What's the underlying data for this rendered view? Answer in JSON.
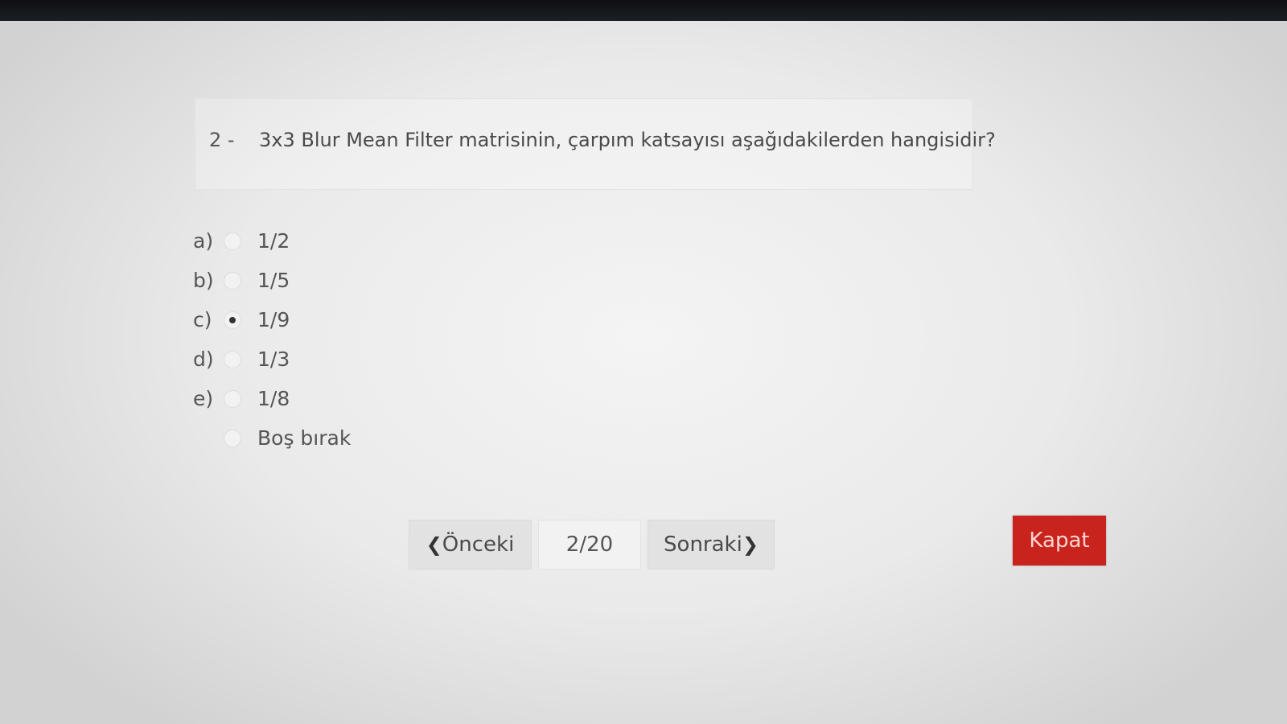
{
  "question": {
    "number": "2 -",
    "text": "3x3 Blur Mean Filter matrisinin, çarpım katsayısı aşağıdakilerden hangisidir?"
  },
  "options": [
    {
      "letter": "a)",
      "text": "1/2",
      "selected": false
    },
    {
      "letter": "b)",
      "text": "1/5",
      "selected": false
    },
    {
      "letter": "c)",
      "text": "1/9",
      "selected": true
    },
    {
      "letter": "d)",
      "text": "1/3",
      "selected": false
    },
    {
      "letter": "e)",
      "text": "1/8",
      "selected": false
    },
    {
      "letter": "",
      "text": "Boş bırak",
      "selected": false
    }
  ],
  "navigation": {
    "prev_label": "Önceki",
    "page_indicator": "2/20",
    "next_label": "Sonraki",
    "prev_icon": "chevron-left-icon",
    "next_icon": "chevron-right-icon"
  },
  "close_button": {
    "label": "Kapat",
    "color": "#c8231c"
  }
}
